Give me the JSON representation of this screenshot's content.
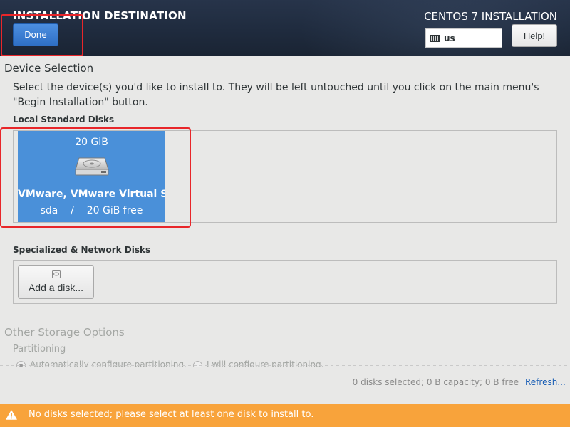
{
  "header": {
    "title": "INSTALLATION DESTINATION",
    "done_label": "Done",
    "product_title": "CENTOS 7 INSTALLATION",
    "keyboard_layout": "us",
    "help_label": "Help!"
  },
  "device_selection": {
    "heading": "Device Selection",
    "intro": "Select the device(s) you'd like to install to.  They will be left untouched until you click on the main menu's \"Begin Installation\" button.",
    "local_disks_label": "Local Standard Disks",
    "disks": [
      {
        "size": "20 GiB",
        "name": "VMware, VMware Virtual S",
        "details": "sda    /    20 GiB free",
        "icon": "hard-disk-icon"
      }
    ],
    "special_disks_label": "Specialized & Network Disks",
    "add_disk_label": "Add a disk..."
  },
  "other_storage": {
    "heading": "Other Storage Options",
    "partitioning_label": "Partitioning",
    "options": [
      {
        "label": "Automatically configure partitioning.",
        "checked": true
      },
      {
        "label": "I will configure partitioning.",
        "checked": false
      }
    ]
  },
  "summary": {
    "text": "0 disks selected; 0 B capacity; 0 B free",
    "refresh_label": "Refresh..."
  },
  "warning": {
    "text": "No disks selected; please select at least one disk to install to.",
    "icon": "warning-icon"
  },
  "colors": {
    "header_bg": "#1f2b3e",
    "accent_blue": "#4a90d9",
    "warning_bg": "#f8a33b",
    "highlight_red": "#e8262a"
  }
}
